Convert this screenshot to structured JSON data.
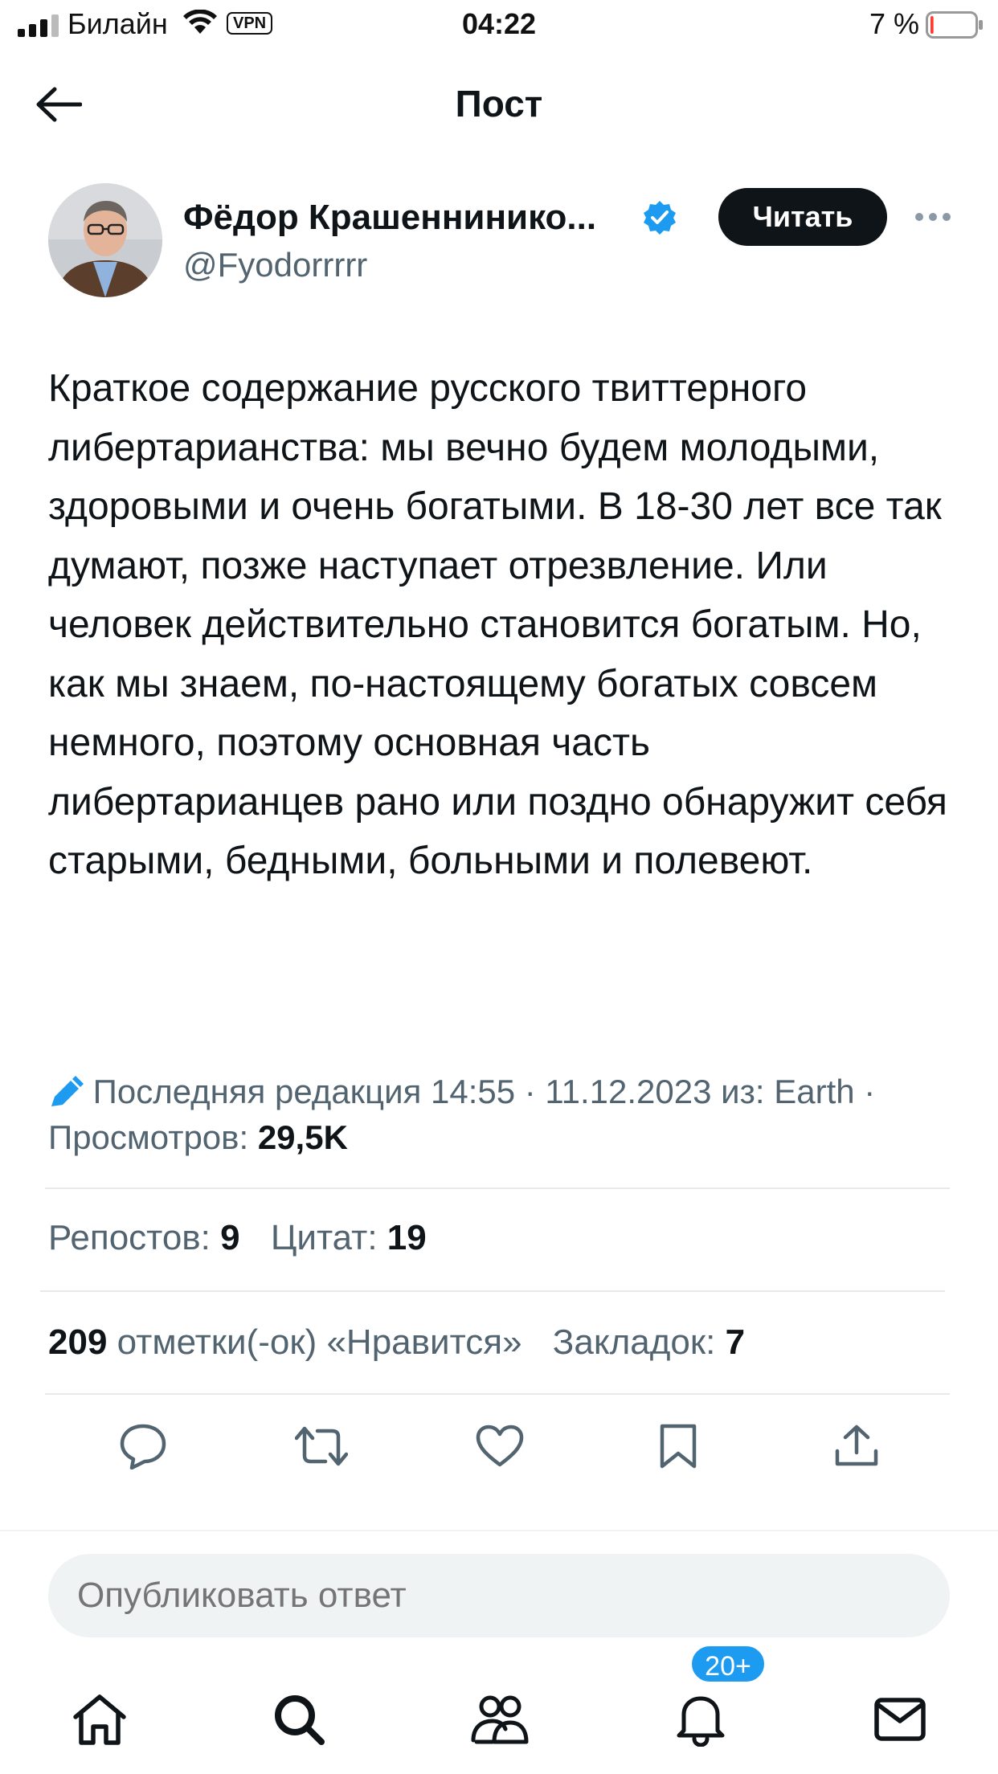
{
  "status_bar": {
    "carrier": "Билайн",
    "vpn": "VPN",
    "time": "04:22",
    "battery_percent": "7 %",
    "battery_level": 0.07
  },
  "nav": {
    "title": "Пост",
    "back_icon": "arrow-left-icon"
  },
  "author": {
    "name": "Фёдор Крашеннинико...",
    "handle": "@Fyodorrrrr",
    "verified": true,
    "follow_label": "Читать",
    "more_icon": "ellipsis-icon"
  },
  "post": {
    "text": "Краткое содержание русского твиттерного либертарианства: мы вечно будем молодыми, здоровыми и очень богатыми. В 18-30 лет все так думают, позже наступает отрезвление. Или человек действительно становится богатым. Но, как мы знаем, по-настоящему богатых совсем немного, поэтому основная часть либертарианцев рано или поздно обнаружит себя старыми, бедными, больными и полевеют."
  },
  "meta": {
    "edited": "Последняя редакция 14:55 · 11.12.2023",
    "source": "из: Earth ·",
    "views_label": "Просмотров:",
    "views_value": "29,5K"
  },
  "stats": {
    "reposts_label": "Репостов:",
    "reposts_value": "9",
    "quotes_label": "Цитат:",
    "quotes_value": "19",
    "likes_value": "209",
    "likes_label": "отметки(-ок) «Нравится»",
    "bookmarks_label": "Закладок:",
    "bookmarks_value": "7"
  },
  "actions": [
    "reply-icon",
    "repost-icon",
    "like-icon",
    "bookmark-icon",
    "share-icon"
  ],
  "reply": {
    "placeholder": "Опубликовать ответ"
  },
  "tab_bar": {
    "tabs": [
      "home-icon",
      "search-icon",
      "communities-icon",
      "notifications-icon",
      "messages-icon"
    ],
    "notifications_badge": "20+"
  },
  "colors": {
    "accent": "#1d9bf0",
    "text": "#0f1419",
    "secondary": "#536471",
    "battery_low": "#ff3b30"
  }
}
